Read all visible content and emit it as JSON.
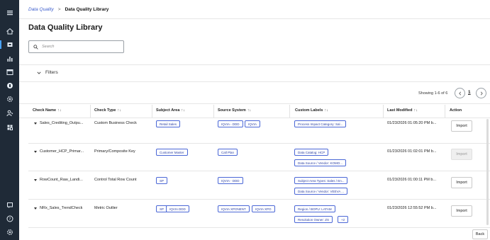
{
  "breadcrumb": {
    "parent": "Data Quality",
    "separator": ">",
    "current": "Data Quality Library"
  },
  "page": {
    "title": "Data Quality Library"
  },
  "search": {
    "placeholder": "Search",
    "value": ""
  },
  "filters": {
    "label": "Filters"
  },
  "pagination": {
    "showing": "Showing 1-6 of 6",
    "page": "1"
  },
  "table": {
    "columns": [
      "Check Name",
      "Check Type",
      "Subject Area",
      "Source System",
      "Custom Labels",
      "Last Modified",
      "Action"
    ],
    "sort_glyph": "↑↓",
    "rows": [
      {
        "name": "Sales_Crediting_Outpu...",
        "type": "Custom Business Check",
        "subject": [
          "Retail Sales"
        ],
        "source": [
          "IQVIA - DDD",
          "IQVIA"
        ],
        "labels": [
          "Process Impact Category: Sal..."
        ],
        "modified": "01/23/2026 01:05:20 PM b...",
        "action": "Import",
        "action_disabled": false
      },
      {
        "name": "Customer_HCP_Primar...",
        "type": "Primary/Composite Key",
        "subject": [
          "Customer Master"
        ],
        "source": [
          "Call Plan"
        ],
        "labels": [
          "Data Catalog: HCP",
          "Data Source / Vendor: KOMO..."
        ],
        "modified": "01/23/2026 01:02:01 PM b...",
        "action": "Import",
        "action_disabled": true
      },
      {
        "name": "RowCount_Raw_Landi...",
        "type": "Control Total Row Count",
        "subject": [
          "SP"
        ],
        "source": [
          "IQVIA - DDD"
        ],
        "labels": [
          "Subject Area Types: Sales / En...",
          "Data Source / Vendor: VEEVA ..."
        ],
        "modified": "01/23/2026 01:00:11 PM b...",
        "action": "Import",
        "action_disabled": false
      },
      {
        "name": "NRx_Sales_TrendCheck",
        "type": "Metric Outlier",
        "subject": [
          "SP",
          "IQVIA DDD"
        ],
        "source": [
          "IQVIA XPONENT",
          "IQVIA XPO"
        ],
        "labels": [
          "Region / BOPU: LATAM",
          "Resolution Owner: ZS",
          "+2"
        ],
        "modified": "01/23/2026 12:55:52 PM b...",
        "action": "Import",
        "action_disabled": false
      }
    ]
  },
  "footer": {
    "back": "Back"
  },
  "rail_icons": [
    "menu-icon",
    "home-icon",
    "library-icon",
    "chart-icon",
    "window-icon",
    "lightbulb-icon",
    "settings-icon",
    "users-icon",
    "grid-icon",
    "chat-icon",
    "help-icon",
    "gear-icon"
  ],
  "colors": {
    "rail": "#1f2a37",
    "accent": "#4a67d6",
    "link": "#3b5ccc"
  }
}
